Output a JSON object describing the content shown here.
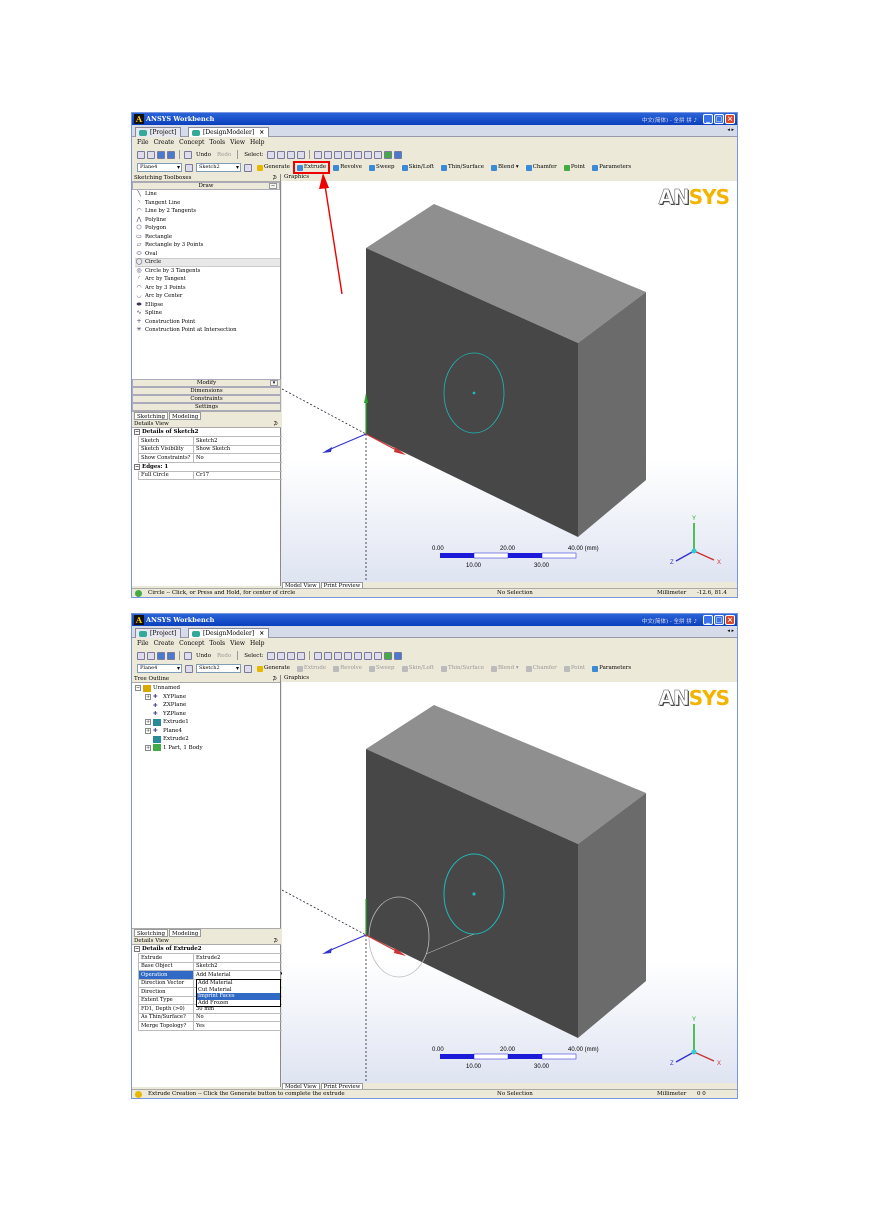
{
  "app": {
    "title": "ANSYS Workbench",
    "ime_text": "中文(简体) - 全拼 拼 ♪",
    "tabs": [
      {
        "label": "[Project]"
      },
      {
        "label": "[DesignModeler]"
      }
    ],
    "menu": [
      "File",
      "Create",
      "Concept",
      "Tools",
      "View",
      "Help"
    ]
  },
  "toolbar1": {
    "undo": "Undo",
    "redo": "Redo",
    "select": "Select:"
  },
  "toolbar2": {
    "plane_value": "Plane4",
    "sketch_value": "Sketch2",
    "generate": "Generate",
    "extrude": "Extrude",
    "revolve": "Revolve",
    "sweep": "Sweep",
    "skin_loft": "Skin/Loft",
    "thin_surface": "Thin/Surface",
    "blend": "Blend ▾",
    "chamfer": "Chamfer",
    "point": "Point",
    "parameters": "Parameters"
  },
  "shot1": {
    "sketching_toolboxes": "Sketching Toolboxes",
    "draw_header": "Draw",
    "draw_tools": [
      "Line",
      "Tangent Line",
      "Line by 2 Tangents",
      "Polyline",
      "Polygon",
      "Rectangle",
      "Rectangle by 3 Points",
      "Oval",
      "Circle",
      "Circle by 3 Tangents",
      "Arc by Tangent",
      "Arc by 3 Points",
      "Arc by Center",
      "Ellipse",
      "Spline",
      "Construction Point",
      "Construction Point at Intersection"
    ],
    "modify": "Modify",
    "dimensions": "Dimensions",
    "constraints": "Constraints",
    "settings": "Settings",
    "subtabs": [
      "Sketching",
      "Modeling"
    ],
    "details_view": "Details View",
    "details_title": "Details of Sketch2",
    "details_rows": [
      {
        "k": "Sketch",
        "v": "Sketch2"
      },
      {
        "k": "Sketch Visibility",
        "v": "Show Sketch"
      },
      {
        "k": "Show Constraints?",
        "v": "No"
      }
    ],
    "edges_group": "Edges: 1",
    "edge_rows": [
      {
        "k": "Full Circle",
        "v": "Cr17"
      }
    ],
    "graphics": "Graphics",
    "gtabs": [
      "Model View",
      "Print Preview"
    ],
    "status": "Circle -- Click, or Press and Hold, for center of circle",
    "selection": "No Selection",
    "units": "Millimeter",
    "coords": "-12.6, 81.4"
  },
  "shot2": {
    "tree_outline": "Tree Outline",
    "tree": [
      "Unnamed",
      "XYPlane",
      "ZXPlane",
      "YZPlane",
      "Extrude1",
      "Plane4",
      "Extrude2",
      "1 Part, 1 Body"
    ],
    "subtabs": [
      "Sketching",
      "Modeling"
    ],
    "details_view": "Details View",
    "details_title": "Details of Extrude2",
    "details_rows": [
      {
        "k": "Extrude",
        "v": "Extrude2"
      },
      {
        "k": "Base Object",
        "v": "Sketch2"
      },
      {
        "k": "Operation",
        "v": "Add Material"
      },
      {
        "k": "Direction Vector",
        "v": ""
      },
      {
        "k": "Direction",
        "v": ""
      },
      {
        "k": "Extent Type",
        "v": ""
      },
      {
        "k": "FD1, Depth (>0)",
        "v": "30 mm"
      },
      {
        "k": "As Thin/Surface?",
        "v": "No"
      },
      {
        "k": "Merge Topology?",
        "v": "Yes"
      }
    ],
    "operation_options": [
      "Add Material",
      "Cut Material",
      "Imprint Faces",
      "Add Frozen"
    ],
    "graphics": "Graphics",
    "gtabs": [
      "Model View",
      "Print Preview"
    ],
    "status": "Extrude Creation -- Click the Generate button to complete the extrude",
    "selection": "No Selection",
    "units": "Millimeter",
    "coords": "0     0"
  },
  "scale": {
    "labels_top": [
      "0.00",
      "20.00",
      "40.00 (mm)"
    ],
    "labels_bottom": [
      "10.00",
      "30.00"
    ]
  },
  "logo": {
    "an": "AN",
    "sys": "SYS"
  },
  "triad": {
    "x": "X",
    "y": "Y",
    "z": "Z"
  },
  "colors": {
    "accent_blue": "#0a3fbd",
    "highlight_red": "#e00000",
    "sketch_cyan": "#20b8b8",
    "ansys_yellow": "#f2b400"
  }
}
